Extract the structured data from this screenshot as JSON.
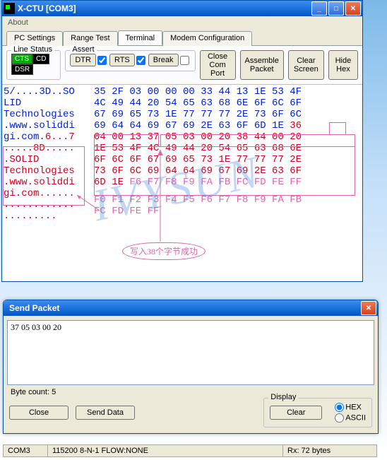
{
  "main_window": {
    "title": "X-CTU   [COM3]",
    "menu": {
      "about": "About"
    },
    "tabs": [
      "PC Settings",
      "Range Test",
      "Terminal",
      "Modem Configuration"
    ],
    "active_tab": 2,
    "line_status": {
      "legend": "Line Status",
      "cts": "CTS",
      "cd": "CD",
      "dsr": "DSR"
    },
    "assert": {
      "legend": "Assert",
      "dtr": "DTR",
      "rts": "RTS",
      "break": "Break"
    },
    "buttons": {
      "close_com": "Close\nCom Port",
      "assemble": "Assemble\nPacket",
      "clear": "Clear\nScreen",
      "hide": "Hide\nHex"
    },
    "ascii_lines": [
      {
        "t": "5/....3D..SO",
        "c": "blue"
      },
      {
        "t": "LID ",
        "c": "blue"
      },
      {
        "t": "Technologies",
        "c": "blue"
      },
      {
        "t": ".www.soliddi",
        "c": "blue"
      },
      {
        "t": "gi.com.",
        "c": "blue",
        "tail": "6...7",
        "tc": "red"
      },
      {
        "t": ".....8D.....",
        "c": "red"
      },
      {
        "t": ".SOLID ",
        "c": "red"
      },
      {
        "t": "Technologies",
        "c": "red"
      },
      {
        "t": ".www.soliddi",
        "c": "red"
      },
      {
        "t": "gi.com......",
        "c": "red"
      },
      {
        "t": "............",
        "c": "red"
      },
      {
        "t": ".........",
        "c": "red"
      }
    ],
    "hex_lines": [
      {
        "t": "35 2F 03 00 00 00 33 44 13 1E 53 4F",
        "c": "blue"
      },
      {
        "t": "4C 49 44 20 54 65 63 68 6E 6F 6C 6F",
        "c": "blue"
      },
      {
        "t": "67 69 65 73 1E 77 77 77 2E 73 6F 6C",
        "c": "blue"
      },
      {
        "t": "69 64 64 69 67 69 2E 63 6F 6D 1E",
        "c": "blue",
        "tail": " 36",
        "tc": "red"
      },
      {
        "t": "04 00 13 ",
        "c": "red",
        "tail": "37 05 03 00 20 38 44 00 20",
        "tc": "red"
      },
      {
        "t": "1E 53 4F 4C 49 44 20 54 65 63 68 6E",
        "c": "red"
      },
      {
        "t": "6F 6C 6F 67 69 65 73 1E 77 77 77 2E",
        "c": "red"
      },
      {
        "t": "73 6F 6C 69 64 64 69 67 69 2E 63 6F",
        "c": "red"
      },
      {
        "t": "6D 1E ",
        "c": "red",
        "tail": "F6 F7 F8 F9 FA FB FC FD FE FF",
        "tc": "rose"
      }
    ],
    "rose_lines": [
      "F0 F1 F2 F3 F4 F5 F6 F7 F8 F9 FA FB",
      "FC FD FE FF"
    ],
    "annotation": "写入38个字节成功"
  },
  "popup": {
    "title": "Send Packet",
    "input_value": "37 05 03 00 20",
    "byte_count_label": "Byte count: 5",
    "close": "Close",
    "send": "Send Data",
    "display": {
      "legend": "Display",
      "clear": "Clear",
      "hex": "HEX",
      "ascii": "ASCII"
    }
  },
  "statusbar": {
    "com": "COM3",
    "cfg": "115200 8-N-1  FLOW:NONE",
    "rx": "Rx: 72 bytes"
  },
  "watermark_en": "IVYSUN"
}
